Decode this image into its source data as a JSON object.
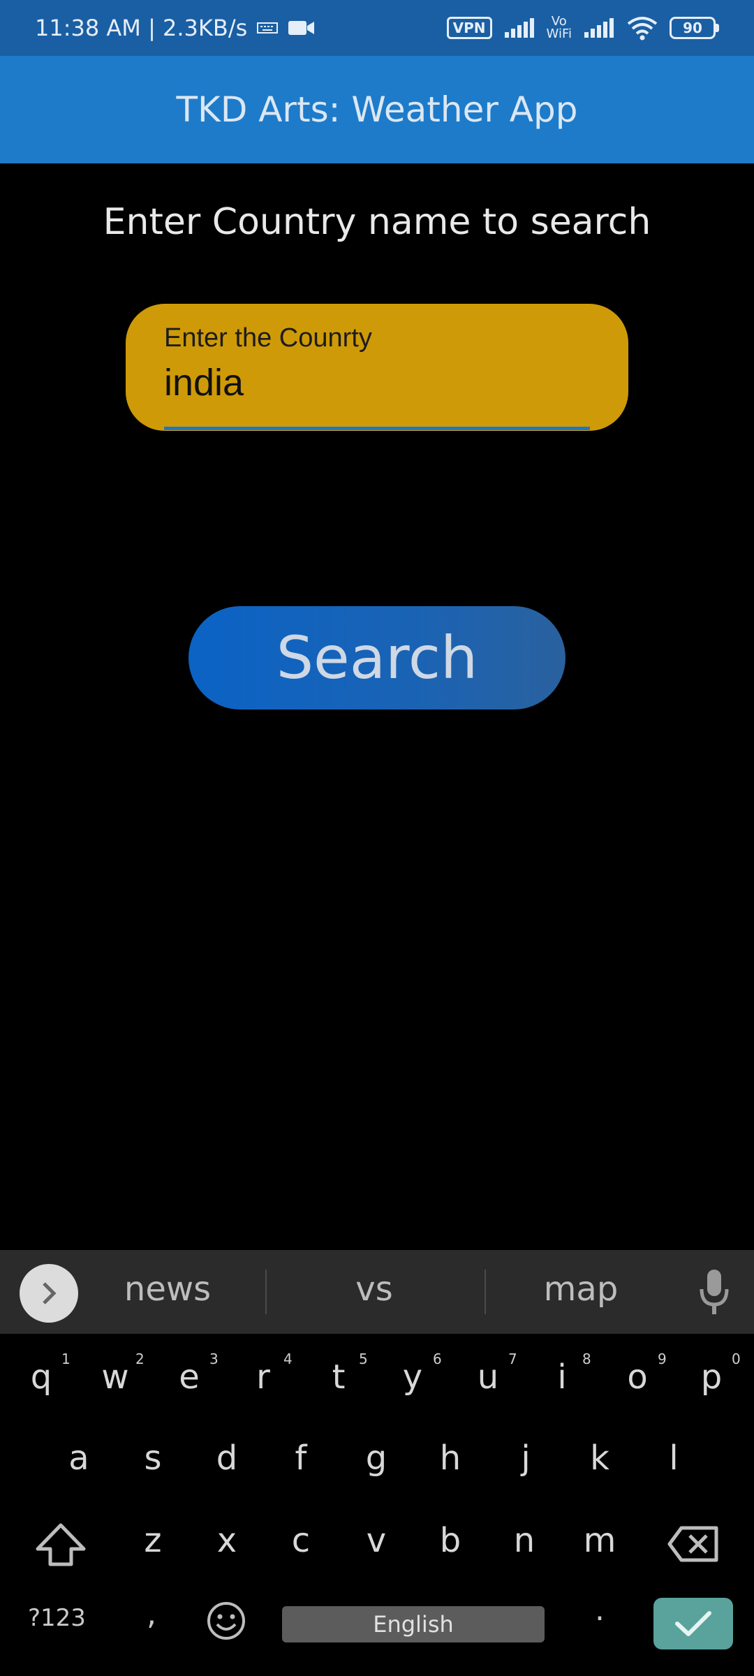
{
  "status_bar": {
    "time_speed": "11:38 AM | 2.3KB/s",
    "vpn": "VPN",
    "vowifi_top": "Vo",
    "vowifi_bottom": "WiFi",
    "battery": "90"
  },
  "app_bar": {
    "title": "TKD Arts: Weather App"
  },
  "main": {
    "prompt": "Enter Country name to search",
    "input": {
      "label": "Enter the Counrty",
      "value": "india"
    },
    "search_button": "Search"
  },
  "keyboard": {
    "suggestions": [
      "news",
      "vs",
      "map"
    ],
    "row1": [
      {
        "k": "q",
        "n": "1"
      },
      {
        "k": "w",
        "n": "2"
      },
      {
        "k": "e",
        "n": "3"
      },
      {
        "k": "r",
        "n": "4"
      },
      {
        "k": "t",
        "n": "5"
      },
      {
        "k": "y",
        "n": "6"
      },
      {
        "k": "u",
        "n": "7"
      },
      {
        "k": "i",
        "n": "8"
      },
      {
        "k": "o",
        "n": "9"
      },
      {
        "k": "p",
        "n": "0"
      }
    ],
    "row2": [
      "a",
      "s",
      "d",
      "f",
      "g",
      "h",
      "j",
      "k",
      "l"
    ],
    "row3": [
      "z",
      "x",
      "c",
      "v",
      "b",
      "n",
      "m"
    ],
    "symbols_key": "?123",
    "comma_key": ",",
    "space_label": "English",
    "period_key": "."
  },
  "colors": {
    "status_bar": "#1a5fa3",
    "app_bar": "#1d7bca",
    "input_fill": "#cf9a07",
    "button": "#0b63c5",
    "enter_key": "#5aa29c"
  }
}
